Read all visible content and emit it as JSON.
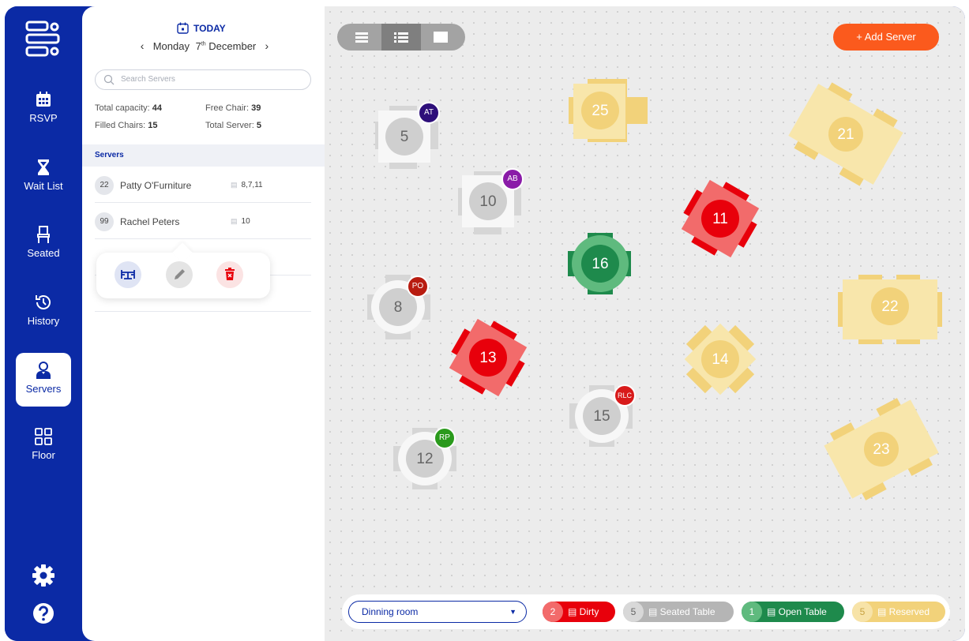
{
  "sidebar": {
    "items": [
      {
        "label": "RSVP",
        "icon": "calendar-icon"
      },
      {
        "label": "Wait List",
        "icon": "hourglass-icon"
      },
      {
        "label": "Seated",
        "icon": "chair-icon"
      },
      {
        "label": "History",
        "icon": "history-icon"
      },
      {
        "label": "Servers",
        "icon": "server-person-icon",
        "active": true
      },
      {
        "label": "Floor",
        "icon": "grid-icon"
      }
    ],
    "bottom": [
      "settings-icon",
      "help-icon"
    ]
  },
  "panel": {
    "today_label": "TODAY",
    "date_day": "Monday",
    "date_num": "7",
    "date_suffix": "th",
    "date_month": "December",
    "search_placeholder": "Search Servers",
    "stats": {
      "total_capacity_label": "Total capacity:",
      "total_capacity": "44",
      "free_chair_label": "Free Chair:",
      "free_chair": "39",
      "filled_chairs_label": "Filled Chairs:",
      "filled_chairs": "15",
      "total_server_label": "Total Server:",
      "total_server": "5"
    },
    "section_title": "Servers",
    "servers": [
      {
        "num": "22",
        "name": "Patty O'Furniture",
        "tables": "8,7,11"
      },
      {
        "num": "99",
        "name": "Rachel Peters",
        "tables": "10"
      }
    ],
    "popup_actions": [
      "assign-table-icon",
      "edit-icon",
      "delete-icon"
    ]
  },
  "floor": {
    "add_server_label": "+ Add Server",
    "view_modes": [
      "list-view-icon",
      "detail-view-icon",
      "card-view-icon"
    ],
    "tables": [
      {
        "num": "5",
        "status": "seated",
        "server": "AT",
        "server_color": "#2e0f7a"
      },
      {
        "num": "25",
        "status": "reserved"
      },
      {
        "num": "21",
        "status": "reserved"
      },
      {
        "num": "10",
        "status": "seated",
        "server": "AB",
        "server_color": "#8a1ba8"
      },
      {
        "num": "11",
        "status": "dirty"
      },
      {
        "num": "16",
        "status": "open"
      },
      {
        "num": "8",
        "status": "seated",
        "server": "PO",
        "server_color": "#b81c10"
      },
      {
        "num": "22",
        "status": "reserved"
      },
      {
        "num": "13",
        "status": "dirty"
      },
      {
        "num": "14",
        "status": "reserved"
      },
      {
        "num": "15",
        "status": "seated",
        "server": "RLC",
        "server_color": "#d81b1b"
      },
      {
        "num": "12",
        "status": "seated",
        "server": "RP",
        "server_color": "#2a9a1c"
      },
      {
        "num": "23",
        "status": "reserved"
      }
    ],
    "room_select": "Dinning room",
    "legend": [
      {
        "count": "2",
        "label": "Dirty",
        "color": "#e8000b",
        "count_bg": "#f26b6b"
      },
      {
        "count": "5",
        "label": "Seated Table",
        "color": "#b5b5b5",
        "count_bg": "#d8d8d8"
      },
      {
        "count": "1",
        "label": "Open Table",
        "color": "#1e8a4c",
        "count_bg": "#5fba7e"
      },
      {
        "count": "5",
        "label": "Reserved",
        "color": "#f2d27a",
        "count_bg": "#f7e3a8"
      }
    ]
  }
}
